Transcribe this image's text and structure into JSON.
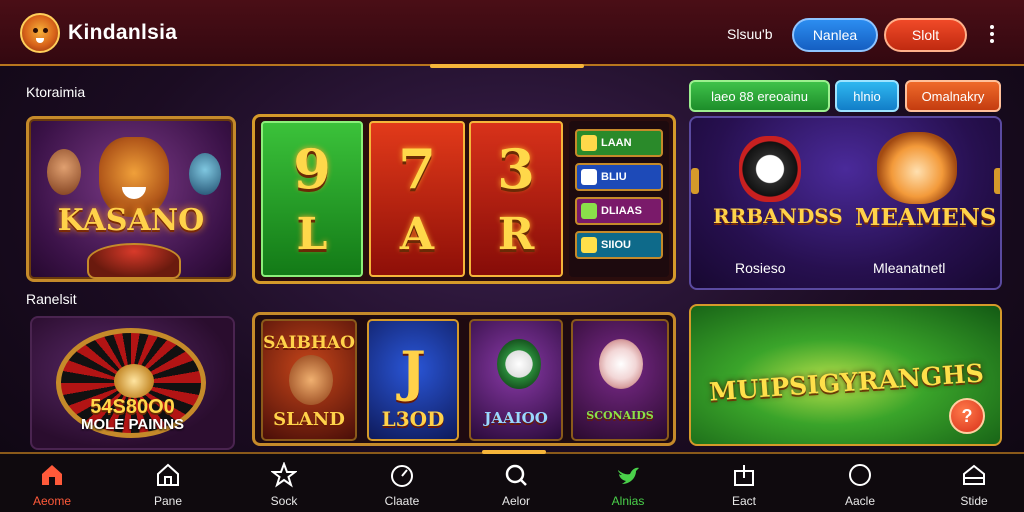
{
  "header": {
    "app_name": "Kindanlsia",
    "logo_icon": "lion-logo-icon",
    "status_text": "Slsuu'b",
    "buttons": [
      {
        "label": "Nanlea",
        "color": "#1f74d8"
      },
      {
        "label": "Slolt",
        "color": "#d8361a"
      }
    ],
    "menu_icon": "kebab-menu-icon"
  },
  "sections": {
    "top_label": "Ktoraimia",
    "bottom_label": "Ranelsit"
  },
  "chips": [
    {
      "label": "laeo 88 ereoainu",
      "color": "#2aa836"
    },
    {
      "label": "hlnio",
      "color": "#1d9de0"
    },
    {
      "label": "Omalnakry",
      "color": "#dd4e1c"
    }
  ],
  "featured": {
    "title": "KASANO"
  },
  "reels": {
    "reel1": [
      "9",
      "L"
    ],
    "reel2": [
      "7",
      "A"
    ],
    "reel3": [
      "3",
      "R"
    ],
    "mini": [
      {
        "label": "LAAN",
        "color": "#2a8a2a"
      },
      {
        "label": "BLIU",
        "color": "#1d4ab8"
      },
      {
        "label": "DLIAAS",
        "color": "#7a1a6a"
      },
      {
        "label": "SIIOU",
        "color": "#0e6a8a"
      }
    ]
  },
  "pair": {
    "left_title": "RRBANDSS",
    "right_title": "MEAMENS",
    "left_caption": "Rosieso",
    "right_caption": "Mleanatnetl"
  },
  "roulette": {
    "amount": "54S80O0",
    "caption": "MOLE PAINNS"
  },
  "games": [
    {
      "title": "SAIBHAO",
      "subtitle": "SLAND"
    },
    {
      "title": "J",
      "subtitle": "L3OD"
    },
    {
      "title": "JAAIOO"
    },
    {
      "title": "SCONAIDS"
    }
  ],
  "multi": {
    "title": "MUIPSIGYRANGHS",
    "help_label": "?"
  },
  "nav": {
    "items": [
      {
        "label": "Aeome",
        "icon": "home-icon",
        "state": "active"
      },
      {
        "label": "Pane",
        "icon": "house-outline-icon",
        "state": ""
      },
      {
        "label": "Sock",
        "icon": "star-icon",
        "state": ""
      },
      {
        "label": "Claate",
        "icon": "clock-icon",
        "state": ""
      },
      {
        "label": "Aelor",
        "icon": "search-icon",
        "state": ""
      },
      {
        "label": "Alnias",
        "icon": "bird-icon",
        "state": "green"
      },
      {
        "label": "Eact",
        "icon": "box-icon",
        "state": ""
      },
      {
        "label": "Aacle",
        "icon": "circle-icon",
        "state": ""
      },
      {
        "label": "Stide",
        "icon": "shop-icon",
        "state": ""
      }
    ]
  }
}
